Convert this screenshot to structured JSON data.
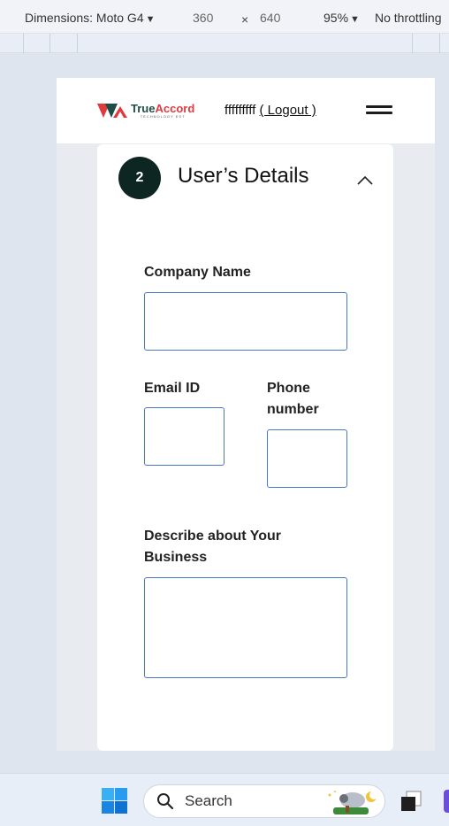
{
  "devtools": {
    "dimensions_label": "Dimensions: Moto G4",
    "width": "360",
    "times": "×",
    "height": "640",
    "zoom": "95%",
    "throttle": "No throttling",
    "dropdown_arrow": "▼"
  },
  "header": {
    "logo_name_part1": "True",
    "logo_name_part2": "Accord",
    "logo_tagline": "TECHNOLOGY EST",
    "username": "fffffffff",
    "logout_label": "( Logout )"
  },
  "section": {
    "step_number": "2",
    "title": "User’s Details"
  },
  "form": {
    "company_name_label": "Company Name",
    "company_name_value": "",
    "email_label": "Email ID",
    "email_value": "",
    "phone_label_line1": "Phone",
    "phone_label_line2": "number",
    "phone_value": "",
    "business_label_line1": "Describe about Your",
    "business_label_line2": "Business",
    "business_value": ""
  },
  "taskbar": {
    "search_label": "Search"
  },
  "colors": {
    "brand_dark": "#1e4d46",
    "brand_red": "#e0393e",
    "step_circle": "#0e2622",
    "input_border": "#4a78c9"
  }
}
